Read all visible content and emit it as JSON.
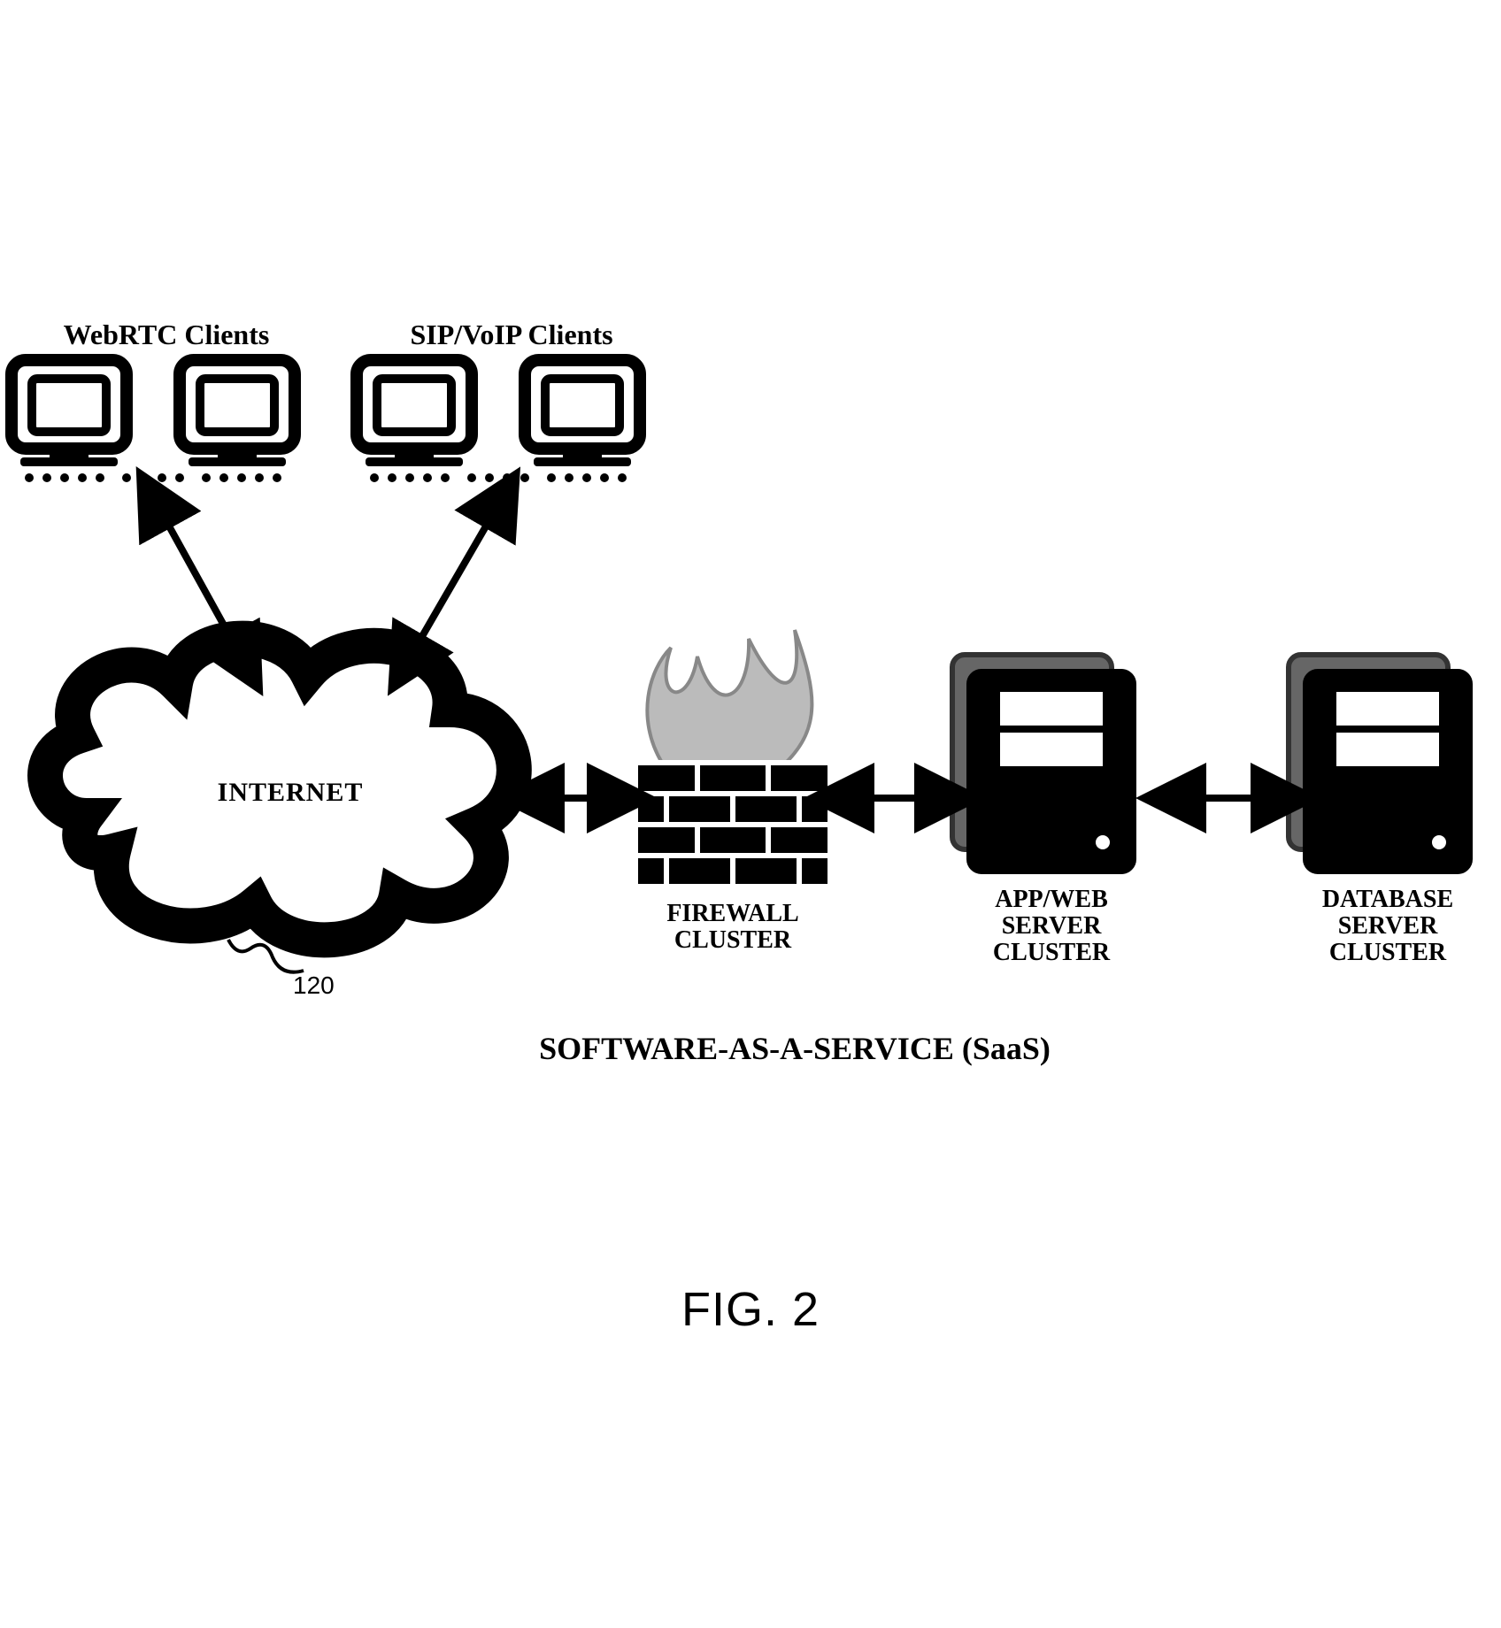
{
  "figure": {
    "caption": "FIG. 2",
    "subtitle": "SOFTWARE-AS-A-SERVICE (SaaS)"
  },
  "clients": {
    "webrtc": "WebRTC  Clients",
    "sip": "SIP/VoIP  Clients"
  },
  "nodes": {
    "internet": "INTERNET",
    "internet_ref": "120",
    "firewall_l1": "FIREWALL",
    "firewall_l2": "CLUSTER",
    "app_l1": "APP/WEB",
    "app_l2": "SERVER",
    "app_l3": "CLUSTER",
    "db_l1": "DATABASE",
    "db_l2": "SERVER",
    "db_l3": "CLUSTER"
  }
}
